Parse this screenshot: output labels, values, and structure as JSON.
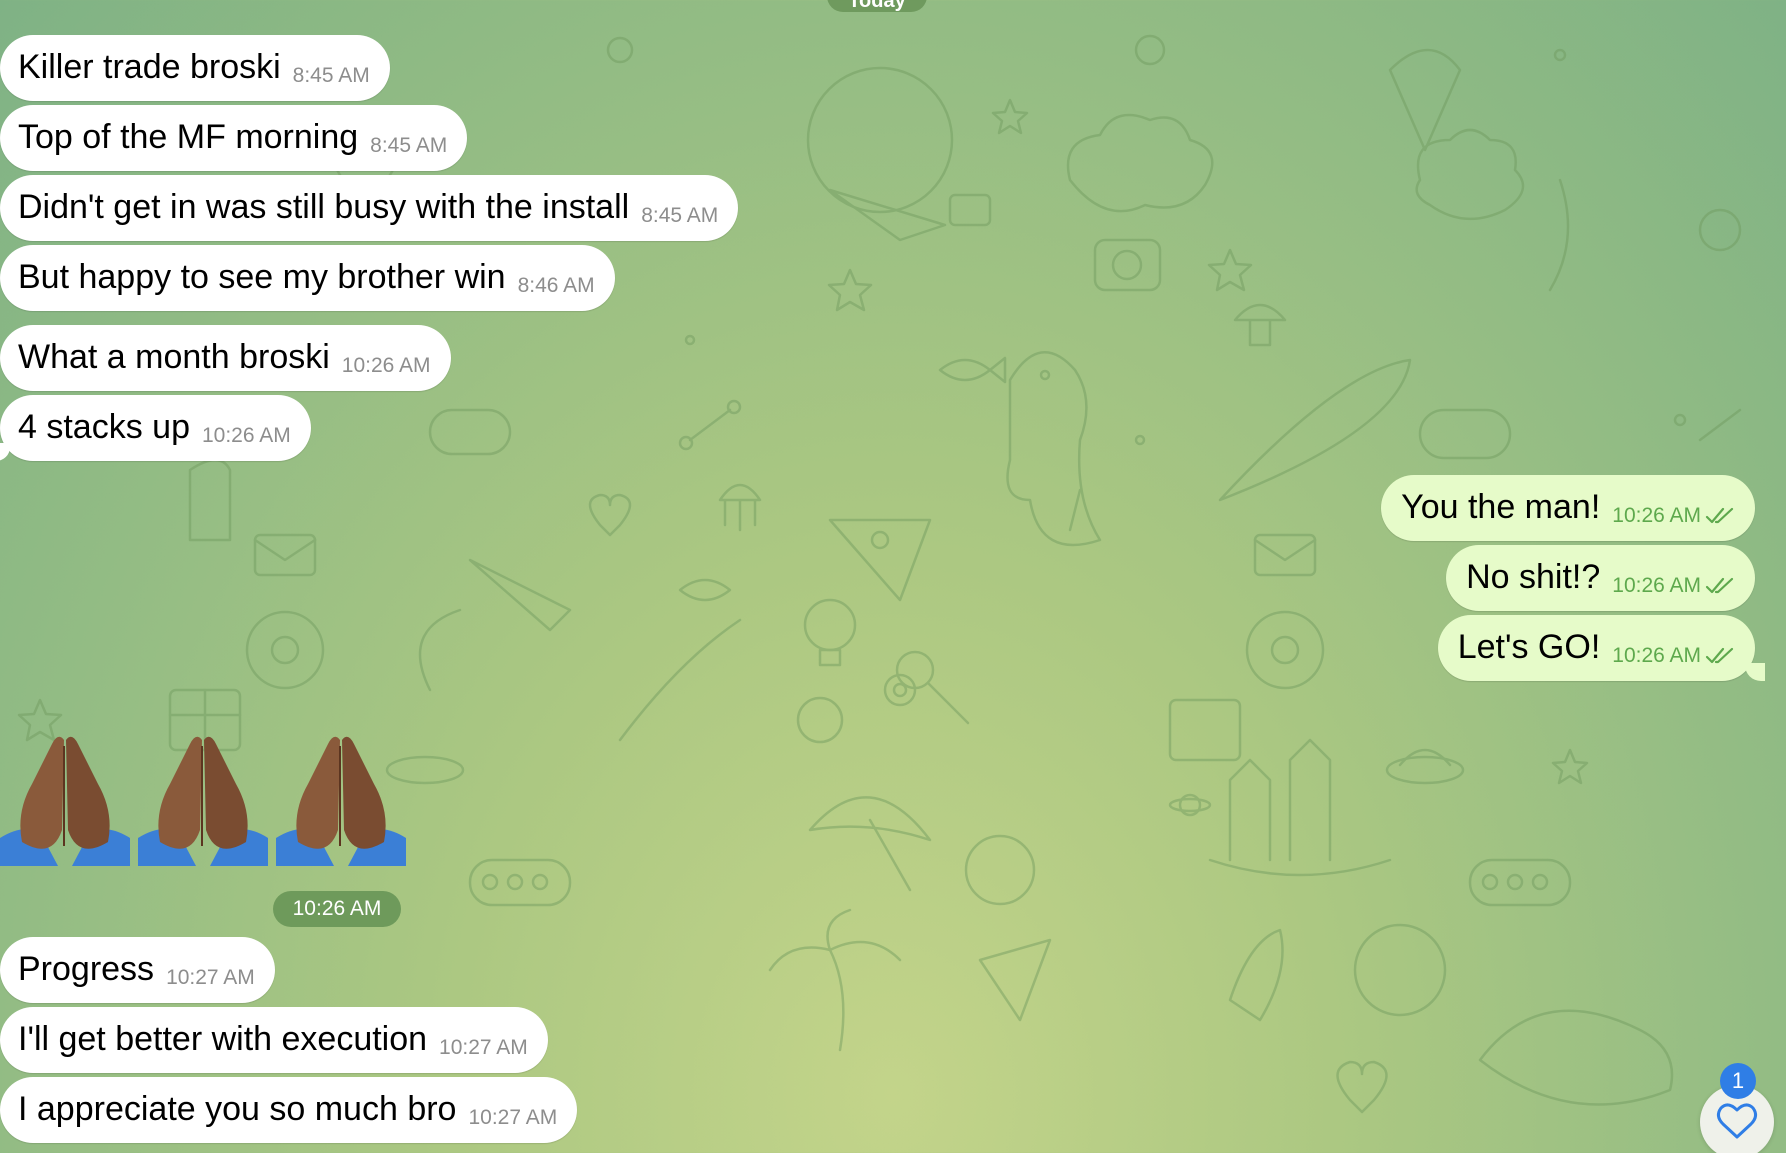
{
  "chat": {
    "date_label": "Today",
    "incoming_a": [
      {
        "text": "Killer trade broski",
        "time": "8:45 AM"
      },
      {
        "text": "Top of the MF morning",
        "time": "8:45 AM"
      },
      {
        "text": "Didn't get in was still busy with the install",
        "time": "8:45 AM"
      },
      {
        "text": "But happy to see my brother win",
        "time": "8:46 AM"
      },
      {
        "text": "What a month broski",
        "time": "10:26 AM"
      },
      {
        "text": "4 stacks up",
        "time": "10:26 AM"
      }
    ],
    "outgoing": [
      {
        "text": "You the man!",
        "time": "10:26 AM"
      },
      {
        "text": "No shit!?",
        "time": "10:26 AM"
      },
      {
        "text": "Let's GO!",
        "time": "10:26 AM"
      }
    ],
    "emoji_message": {
      "emoji_names": [
        "folded-hands-medium-dark",
        "folded-hands-medium-dark",
        "folded-hands-medium-dark"
      ],
      "time": "10:26 AM"
    },
    "incoming_b": [
      {
        "text": "Progress",
        "time": "10:27 AM"
      },
      {
        "text": "I'll get better with execution",
        "time": "10:27 AM"
      },
      {
        "text": "I appreciate you so much bro",
        "time": "10:27 AM"
      }
    ],
    "reaction": {
      "icon": "heart-icon",
      "count": "1"
    }
  },
  "colors": {
    "incoming_bubble": "#ffffff",
    "outgoing_bubble": "#e6fbc9",
    "outgoing_time": "#5ea94d",
    "badge": "#2f7ee6",
    "background": "#a9c786"
  }
}
